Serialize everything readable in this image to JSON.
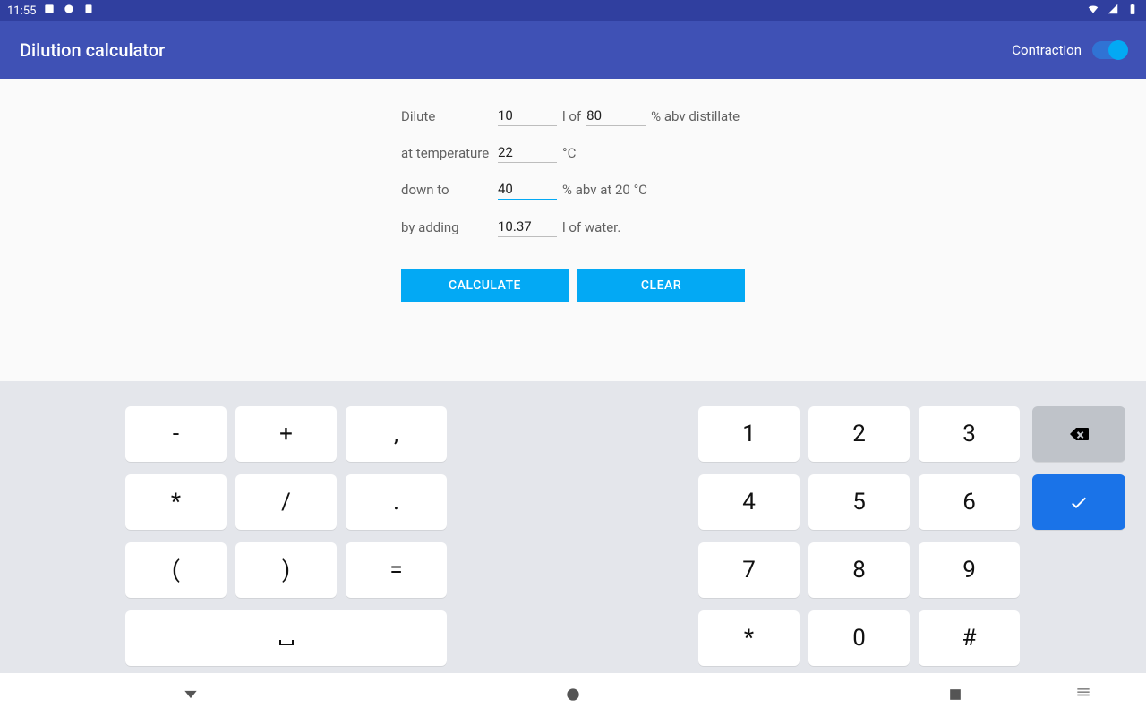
{
  "status": {
    "time": "11:55"
  },
  "appbar": {
    "title": "Dilution calculator",
    "toggle_label": "Contraction",
    "toggle_on": true
  },
  "form": {
    "row1_pre": "Dilute",
    "volume": "10",
    "row1_mid": "l of",
    "abv_in": "80",
    "row1_post": "% abv distillate",
    "row2_pre": "at temperature",
    "temp": "22",
    "row2_post": "°C",
    "row3_pre": "down to",
    "abv_out": "40",
    "row3_post": "% abv at 20 °C",
    "row4_pre": "by adding",
    "water": "10.37",
    "row4_post": "l of water."
  },
  "buttons": {
    "calculate": "CALCULATE",
    "clear": "CLEAR"
  },
  "keys": {
    "minus": "-",
    "plus": "+",
    "comma": ",",
    "star": "*",
    "slash": "/",
    "dot": ".",
    "lparen": "(",
    "rparen": ")",
    "equals": "=",
    "space": "␣",
    "k1": "1",
    "k2": "2",
    "k3": "3",
    "k4": "4",
    "k5": "5",
    "k6": "6",
    "k7": "7",
    "k8": "8",
    "k9": "9",
    "kstar": "*",
    "k0": "0",
    "hash": "#"
  }
}
